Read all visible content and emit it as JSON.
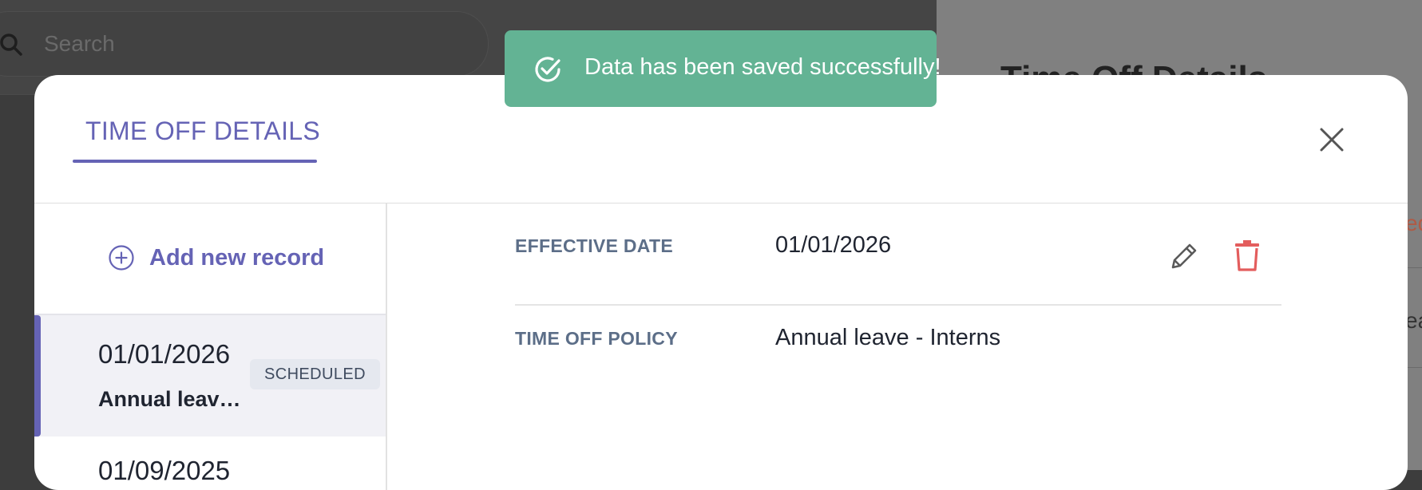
{
  "background": {
    "search_placeholder": "Search",
    "right_panel_title": "Time Off Details",
    "right_panel_red_fragment": "ed",
    "right_panel_text_fragment": "ea"
  },
  "toast": {
    "message": "Data has been saved successfully!",
    "icon": "check-circle-icon",
    "color": "#63b394"
  },
  "modal": {
    "tab_title": "TIME OFF DETAILS",
    "close_icon": "close-icon",
    "accent_color": "#6563b5",
    "sidebar": {
      "add_label": "Add new record",
      "records": [
        {
          "date": "01/01/2026",
          "policy": "Annual leav…",
          "badge": "SCHEDULED"
        },
        {
          "date": "01/09/2025"
        }
      ]
    },
    "details": {
      "effective_date_label": "EFFECTIVE DATE",
      "effective_date_value": "01/01/2026",
      "policy_label": "TIME OFF POLICY",
      "policy_value": "Annual leave - Interns",
      "edit_icon": "pencil-icon",
      "delete_icon": "trash-icon",
      "delete_color": "#e35d5d"
    }
  }
}
